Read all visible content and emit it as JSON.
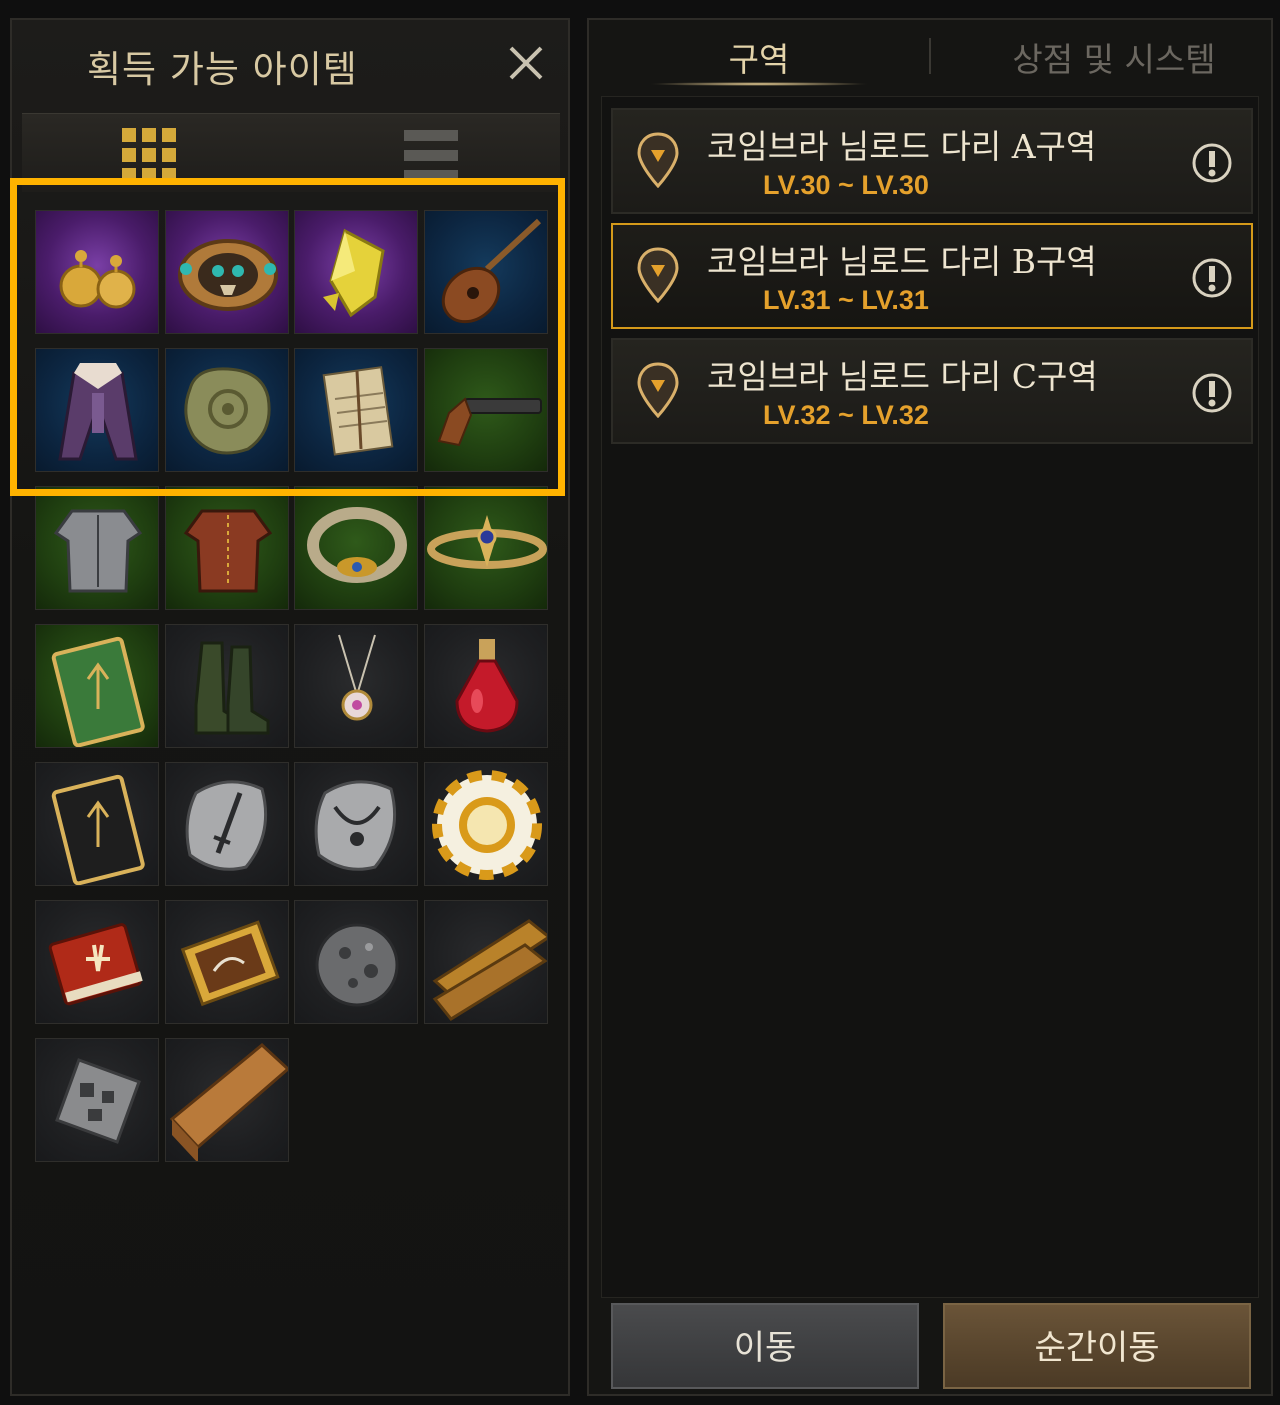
{
  "left_panel": {
    "title": "획득 가능 아이템",
    "close_icon": "close-icon",
    "view_buttons": [
      {
        "icon": "grid-view-icon",
        "active": true
      },
      {
        "icon": "list-view-icon",
        "active": false
      }
    ],
    "items": [
      {
        "icon": "earrings-icon",
        "grade": "purple"
      },
      {
        "icon": "skull-ring-icon",
        "grade": "purple"
      },
      {
        "icon": "yellow-crystal-icon",
        "grade": "purple"
      },
      {
        "icon": "lute-icon",
        "grade": "blue"
      },
      {
        "icon": "coat-icon",
        "grade": "blue"
      },
      {
        "icon": "ancient-relic-icon",
        "grade": "blue"
      },
      {
        "icon": "letters-icon",
        "grade": "blue"
      },
      {
        "icon": "pistol-icon",
        "grade": "green"
      },
      {
        "icon": "plate-armor-icon",
        "grade": "green"
      },
      {
        "icon": "leather-armor-icon",
        "grade": "green"
      },
      {
        "icon": "bracelet-icon",
        "grade": "green"
      },
      {
        "icon": "circlet-icon",
        "grade": "green"
      },
      {
        "icon": "green-card-icon",
        "grade": "green"
      },
      {
        "icon": "boots-icon",
        "grade": "gray"
      },
      {
        "icon": "necklace-icon",
        "grade": "gray"
      },
      {
        "icon": "red-potion-icon",
        "grade": "gray"
      },
      {
        "icon": "black-card-icon",
        "grade": "gray"
      },
      {
        "icon": "sword-stone-icon",
        "grade": "gray"
      },
      {
        "icon": "necklace-stone-icon",
        "grade": "gray"
      },
      {
        "icon": "gold-chip-icon",
        "grade": "gray"
      },
      {
        "icon": "red-book-icon",
        "grade": "gray"
      },
      {
        "icon": "ticket-icon",
        "grade": "gray"
      },
      {
        "icon": "ore-icon",
        "grade": "gray"
      },
      {
        "icon": "planks-icon",
        "grade": "gray"
      },
      {
        "icon": "scrap-metal-icon",
        "grade": "gray"
      },
      {
        "icon": "timber-icon",
        "grade": "gray"
      }
    ]
  },
  "right_panel": {
    "tabs": [
      {
        "label": "구역",
        "active": true
      },
      {
        "label": "상점 및 시스템",
        "active": false
      }
    ],
    "zones": [
      {
        "name": "코임브라 님로드 다리 A구역",
        "level": "LV.30 ~ LV.30",
        "selected": false
      },
      {
        "name": "코임브라 님로드 다리 B구역",
        "level": "LV.31 ~ LV.31",
        "selected": true
      },
      {
        "name": "코임브라 님로드 다리 C구역",
        "level": "LV.32 ~ LV.32",
        "selected": false
      }
    ],
    "buttons": {
      "move": "이동",
      "teleport": "순간이동"
    }
  },
  "colors": {
    "highlight": "#ffb300",
    "level_text": "#e5a12c",
    "selected_border": "#d59a1a",
    "grid_icon": "#d4a93a"
  }
}
